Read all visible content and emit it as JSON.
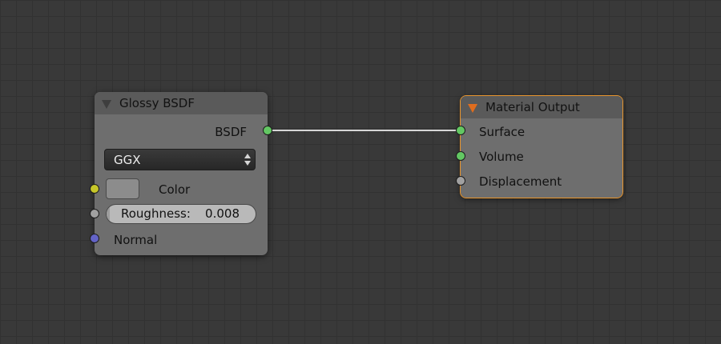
{
  "colors": {
    "socket_shader": "#63c763",
    "socket_color": "#c7c729",
    "socket_value": "#a1a1a1",
    "socket_vector": "#6363c7",
    "selected_outline": "#e8952d",
    "output_icon": "#e06d1e"
  },
  "glossy_node": {
    "title": "Glossy BSDF",
    "outputs": [
      {
        "label": "BSDF",
        "socket": "shader"
      }
    ],
    "distribution": {
      "value": "GGX"
    },
    "inputs": {
      "color": {
        "label": "Color",
        "socket": "color"
      },
      "roughness": {
        "label": "Roughness:",
        "value": "0.008",
        "fraction": 0.008
      },
      "normal": {
        "label": "Normal",
        "socket": "vector"
      }
    }
  },
  "output_node": {
    "title": "Material Output",
    "inputs": [
      {
        "label": "Surface",
        "socket": "shader",
        "connected": true
      },
      {
        "label": "Volume",
        "socket": "shader",
        "connected": false
      },
      {
        "label": "Displacement",
        "socket": "value",
        "connected": false
      }
    ]
  }
}
